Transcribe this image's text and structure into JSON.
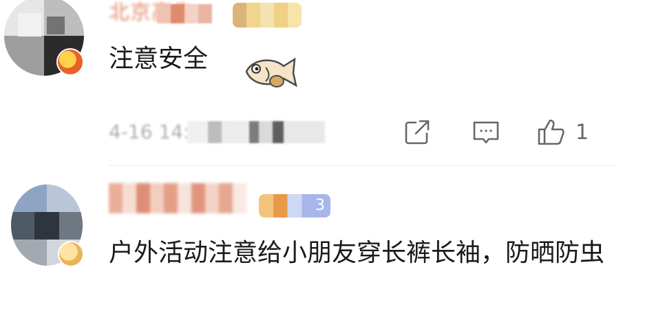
{
  "comments": [
    {
      "username": "北京高先",
      "text": "注意安全",
      "emoji": "fish-emoji",
      "meta": "4-16 14:33 来自北京",
      "actions": {
        "share_icon": "share-icon",
        "reply_icon": "comment-icon",
        "like_icon": "thumbs-up-icon",
        "like_count": "1"
      }
    },
    {
      "username": "",
      "vip_badge": "3",
      "text": "户外活动注意给小朋友穿长裤长袖，防晒防虫"
    }
  ],
  "colors": {
    "username": "#d9603e",
    "text": "#1a1a1a",
    "meta": "#9a9a9a",
    "icon": "#666666",
    "divider": "#ebebeb"
  }
}
